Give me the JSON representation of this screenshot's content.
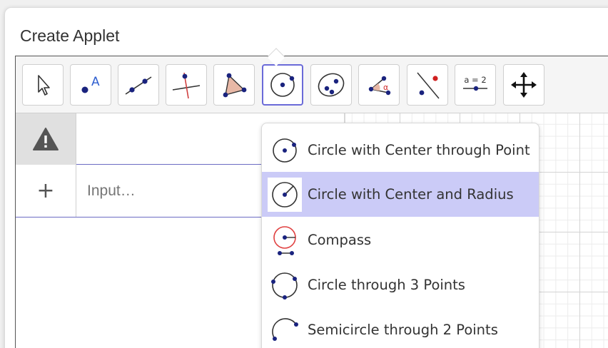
{
  "dialog": {
    "title": "Create Applet"
  },
  "toolbar": {
    "tools": [
      {
        "name": "move-tool",
        "icon": "cursor-arrow-icon"
      },
      {
        "name": "point-tool",
        "icon": "point-a-icon"
      },
      {
        "name": "line-tool",
        "icon": "line-through-points-icon"
      },
      {
        "name": "perpendicular-line-tool",
        "icon": "perpendicular-line-icon"
      },
      {
        "name": "polygon-tool",
        "icon": "polygon-icon"
      },
      {
        "name": "circle-tool",
        "icon": "circle-center-point-icon",
        "active": true
      },
      {
        "name": "ellipse-tool",
        "icon": "ellipse-icon"
      },
      {
        "name": "angle-tool",
        "icon": "angle-icon"
      },
      {
        "name": "reflect-tool",
        "icon": "reflect-about-line-icon"
      },
      {
        "name": "slider-tool",
        "icon": "slider-icon",
        "label": "a = 2"
      },
      {
        "name": "move-graphics-tool",
        "icon": "move-graphics-view-icon"
      }
    ]
  },
  "algebra": {
    "input_placeholder": "Input…",
    "add_symbol": "+",
    "warning_icon": "warning-triangle-icon"
  },
  "menu": {
    "items": [
      {
        "label": "Circle with Center through Point",
        "icon": "circle-center-point-icon",
        "selected": false
      },
      {
        "label": "Circle with Center and Radius",
        "icon": "circle-center-radius-icon",
        "selected": true
      },
      {
        "label": "Compass",
        "icon": "compass-icon",
        "selected": false
      },
      {
        "label": "Circle through 3 Points",
        "icon": "circle-three-points-icon",
        "selected": false
      },
      {
        "label": "Semicircle through 2 Points",
        "icon": "semicircle-icon",
        "selected": false
      }
    ]
  },
  "colors": {
    "accent": "#6a6ad8",
    "selected_bg": "#cbcbf7",
    "point": "#1a237e",
    "polygon_fill": "#e8b8a6",
    "compass_red": "#e04040"
  }
}
